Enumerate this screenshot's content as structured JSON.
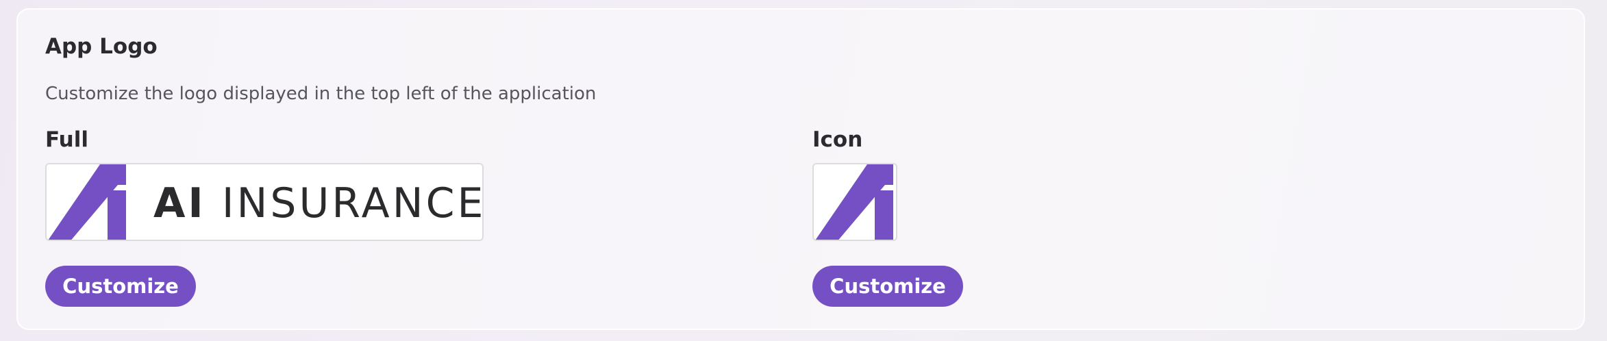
{
  "section": {
    "title": "App Logo",
    "description": "Customize the logo displayed in the top left of the application"
  },
  "full": {
    "label": "Full",
    "logo_text_strong": "AI",
    "logo_text_light": " INSURANCE",
    "button_label": "Customize"
  },
  "icon": {
    "label": "Icon",
    "button_label": "Customize"
  },
  "colors": {
    "accent": "#7550c5",
    "logo_mark": "#7550c5",
    "logo_text": "#2b2b2e"
  }
}
